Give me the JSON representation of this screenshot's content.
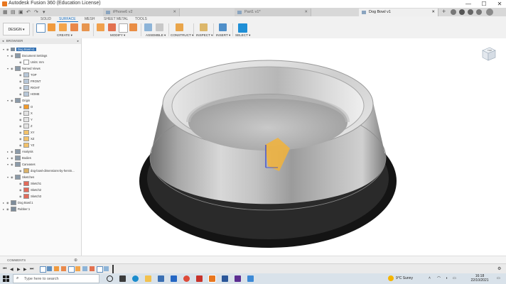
{
  "window": {
    "title": "Autodesk Fusion 360 (Education License)",
    "controls": [
      "—",
      "☐",
      "✕"
    ]
  },
  "tabs": [
    {
      "label": "iPhone6 v2"
    },
    {
      "label": "Part1 v1*"
    },
    {
      "label": "Dog Bowl v1"
    }
  ],
  "workspace_tabs": [
    "SOLID",
    "SURFACE",
    "MESH",
    "SHEET METAL",
    "TOOLS"
  ],
  "workspace_active": "SURFACE",
  "design_button": "DESIGN ▾",
  "tool_groups": [
    {
      "label": "CREATE ▾"
    },
    {
      "label": "MODIFY ▾"
    },
    {
      "label": "ASSEMBLE ▾"
    },
    {
      "label": "CONSTRUCT ▾"
    },
    {
      "label": "INSPECT ▾"
    },
    {
      "label": "INSERT ▾"
    },
    {
      "label": "SELECT ▾"
    }
  ],
  "browser": {
    "title": "BROWSER",
    "root": "Dog Bowl v1",
    "items": [
      {
        "label": "Document Settings"
      },
      {
        "label": "Units: mm"
      },
      {
        "label": "Named Views"
      },
      {
        "label": "TOP"
      },
      {
        "label": "FRONT"
      },
      {
        "label": "RIGHT"
      },
      {
        "label": "HOME"
      },
      {
        "label": "Origin"
      },
      {
        "label": "O"
      },
      {
        "label": "X"
      },
      {
        "label": "Y"
      },
      {
        "label": "Z"
      },
      {
        "label": "XY"
      },
      {
        "label": "XZ"
      },
      {
        "label": "YZ"
      },
      {
        "label": "Analysis"
      },
      {
        "label": "Bodies"
      },
      {
        "label": "Canvases"
      },
      {
        "label": "dog-bowl-dimensions-by-hervin..."
      },
      {
        "label": "Sketches"
      },
      {
        "label": "Sketch1"
      },
      {
        "label": "Sketch2"
      },
      {
        "label": "Sketch3"
      },
      {
        "label": "Dog Bowl:1"
      },
      {
        "label": "Rubber:1"
      }
    ]
  },
  "comments_label": "COMMENTS",
  "viewcube_label": "TOP",
  "taskbar": {
    "search_placeholder": "Type here to search",
    "weather": "9°C  Sunny",
    "time": "16:18",
    "date": "22/10/2021"
  },
  "colors": {
    "accent": "#1c73c4",
    "bowl_steel": "#b9b9b9",
    "rubber": "#1a1a1a"
  }
}
